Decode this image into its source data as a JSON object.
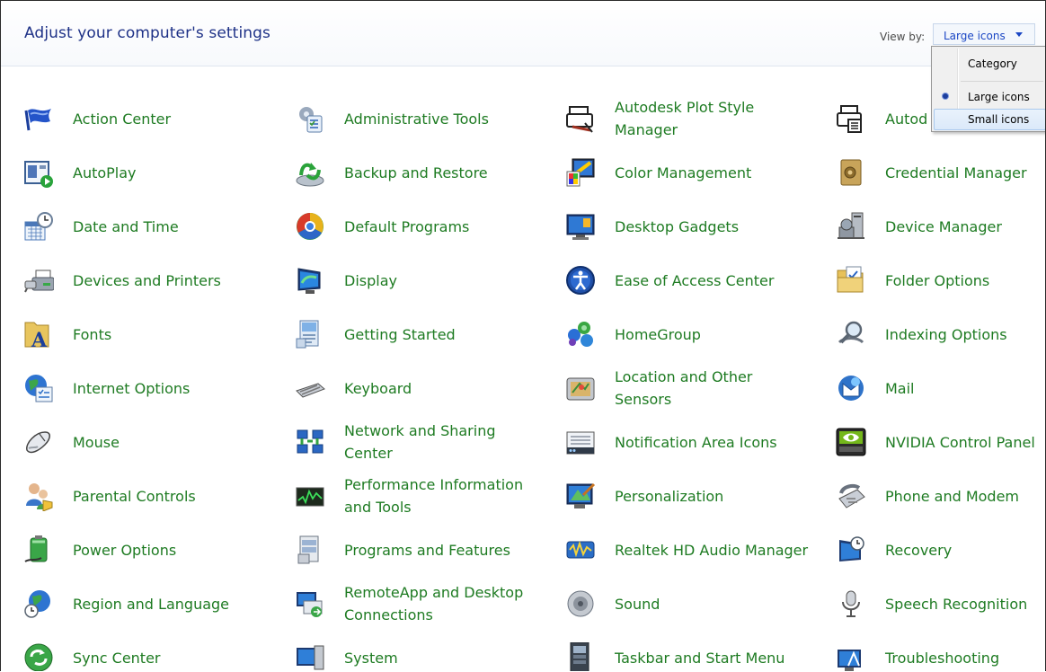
{
  "header": {
    "title": "Adjust your computer's settings",
    "view_by_label": "View by:",
    "view_by_value": "Large icons"
  },
  "view_menu": {
    "items": [
      {
        "label": "Category",
        "selected": false,
        "hover": false
      },
      {
        "label": "Large icons",
        "selected": true,
        "hover": false
      },
      {
        "label": "Small icons",
        "selected": false,
        "hover": true
      }
    ]
  },
  "colors": {
    "link": "#1e7b22",
    "title": "#1e3287",
    "accent": "#1a46c4"
  },
  "items": [
    {
      "label": "Action Center",
      "icon": "flag-icon"
    },
    {
      "label": "Administrative Tools",
      "icon": "admin-tools-icon"
    },
    {
      "label": "Autodesk Plot Style Manager",
      "icon": "plotter-icon"
    },
    {
      "label": "Autod",
      "icon": "plotter-config-icon"
    },
    {
      "label": "AutoPlay",
      "icon": "autoplay-icon"
    },
    {
      "label": "Backup and Restore",
      "icon": "backup-icon"
    },
    {
      "label": "Color Management",
      "icon": "color-management-icon"
    },
    {
      "label": "Credential Manager",
      "icon": "vault-icon"
    },
    {
      "label": "Date and Time",
      "icon": "clock-calendar-icon"
    },
    {
      "label": "Default Programs",
      "icon": "default-programs-icon"
    },
    {
      "label": "Desktop Gadgets",
      "icon": "gadgets-icon"
    },
    {
      "label": "Device Manager",
      "icon": "device-manager-icon"
    },
    {
      "label": "Devices and Printers",
      "icon": "printer-icon"
    },
    {
      "label": "Display",
      "icon": "monitor-icon"
    },
    {
      "label": "Ease of Access Center",
      "icon": "ease-of-access-icon"
    },
    {
      "label": "Folder Options",
      "icon": "folder-icon"
    },
    {
      "label": "Fonts",
      "icon": "fonts-icon"
    },
    {
      "label": "Getting Started",
      "icon": "getting-started-icon"
    },
    {
      "label": "HomeGroup",
      "icon": "homegroup-icon"
    },
    {
      "label": "Indexing Options",
      "icon": "magnifier-icon"
    },
    {
      "label": "Internet Options",
      "icon": "globe-icon"
    },
    {
      "label": "Keyboard",
      "icon": "keyboard-icon"
    },
    {
      "label": "Location and Other Sensors",
      "icon": "location-icon"
    },
    {
      "label": "Mail",
      "icon": "mail-icon"
    },
    {
      "label": "Mouse",
      "icon": "mouse-icon"
    },
    {
      "label": "Network and Sharing Center",
      "icon": "network-icon"
    },
    {
      "label": "Notification Area Icons",
      "icon": "notification-area-icon"
    },
    {
      "label": "NVIDIA Control Panel",
      "icon": "nvidia-icon"
    },
    {
      "label": "Parental Controls",
      "icon": "parental-controls-icon"
    },
    {
      "label": "Performance Information and Tools",
      "icon": "performance-icon"
    },
    {
      "label": "Personalization",
      "icon": "personalization-icon"
    },
    {
      "label": "Phone and Modem",
      "icon": "phone-icon"
    },
    {
      "label": "Power Options",
      "icon": "battery-icon"
    },
    {
      "label": "Programs and Features",
      "icon": "programs-icon"
    },
    {
      "label": "Realtek HD Audio Manager",
      "icon": "audio-icon"
    },
    {
      "label": "Recovery",
      "icon": "recovery-icon"
    },
    {
      "label": "Region and Language",
      "icon": "region-globe-icon"
    },
    {
      "label": "RemoteApp and Desktop Connections",
      "icon": "remote-desktop-icon"
    },
    {
      "label": "Sound",
      "icon": "speaker-icon"
    },
    {
      "label": "Speech Recognition",
      "icon": "microphone-icon"
    },
    {
      "label": "Sync Center",
      "icon": "sync-icon"
    },
    {
      "label": "System",
      "icon": "system-icon"
    },
    {
      "label": "Taskbar and Start Menu",
      "icon": "taskbar-icon"
    },
    {
      "label": "Troubleshooting",
      "icon": "troubleshooting-icon"
    }
  ]
}
